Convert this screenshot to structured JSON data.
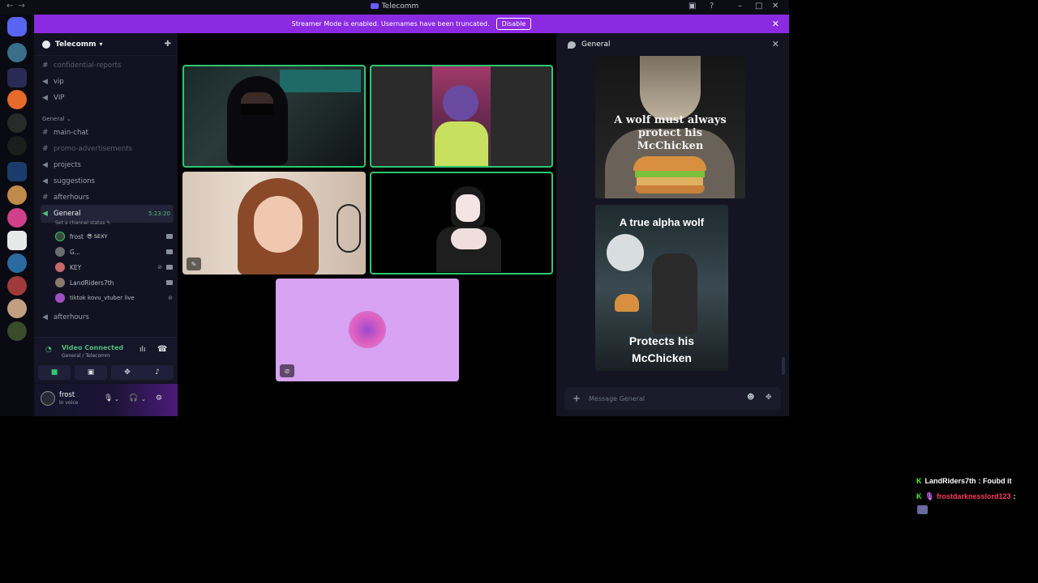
{
  "window": {
    "title": "Telecomm",
    "nav_back": "←",
    "nav_forward": "→",
    "inbox_icon": "inbox-icon",
    "help_icon": "help-icon",
    "minimize": "–",
    "maximize": "□",
    "close": "✕"
  },
  "banner": {
    "text": "Streamer Mode is enabled. Usernames have been truncated.",
    "button": "Disable",
    "close": "✕",
    "color": "#8a2be2"
  },
  "server": {
    "name": "Telecomm",
    "chevron": "⌄",
    "add_icon": "add-member-icon"
  },
  "channels": {
    "top": [
      {
        "label": "confidential-reports",
        "type": "text",
        "muted": true
      },
      {
        "label": "vip",
        "type": "voice",
        "muted": false
      },
      {
        "label": "VIP",
        "type": "voice",
        "muted": false
      }
    ],
    "category": "General",
    "general": [
      {
        "label": "main-chat",
        "type": "text",
        "muted": false
      },
      {
        "label": "promo-advertisements",
        "type": "text",
        "muted": true
      },
      {
        "label": "projects",
        "type": "voice",
        "muted": false
      },
      {
        "label": "suggestions",
        "type": "voice",
        "muted": false
      },
      {
        "label": "afterhours",
        "type": "text",
        "muted": false
      }
    ],
    "active_voice": {
      "label": "General",
      "timer": "5:23:20",
      "status_hint": "Set a channel status"
    },
    "voice_users": [
      {
        "name": "frost",
        "tag": "😎 SEXY",
        "color": "#3a4a3a"
      },
      {
        "name": "G...",
        "tag": "",
        "color": "#6d6d6d"
      },
      {
        "name": "KEY",
        "tag": "",
        "color": "#c46a6a"
      },
      {
        "name": "LandRiders7th",
        "tag": "",
        "color": "#8a7a6a"
      },
      {
        "name": "tiktok kovu_vtuber live",
        "tag": "",
        "color": "#a050c0"
      }
    ],
    "after": {
      "label": "afterhours",
      "type": "voice"
    }
  },
  "voice_panel": {
    "status": "Video Connected",
    "location": "General / Telecomm",
    "buttons": [
      "camera-icon",
      "screen-share-icon",
      "activities-icon",
      "soundboard-icon"
    ],
    "accent": "#4fbd7a"
  },
  "user_panel": {
    "name": "frost",
    "status": "In voice"
  },
  "video": {
    "speaking_color": "#2dc770"
  },
  "chat": {
    "channel": "General",
    "meme1": {
      "caption": "A wolf must always protect his McChicken"
    },
    "meme2": {
      "top": "A true alpha wolf",
      "bottom": "Protects his McChicken"
    },
    "placeholder": "Message General"
  },
  "overlay": {
    "messages": [
      {
        "user": "LandRiders7th",
        "text": ": Foubd it",
        "user_color": "#ffffff"
      },
      {
        "user": "frostdarknesslord123",
        "text": ":",
        "user_color": "#ff3b5c"
      }
    ]
  }
}
